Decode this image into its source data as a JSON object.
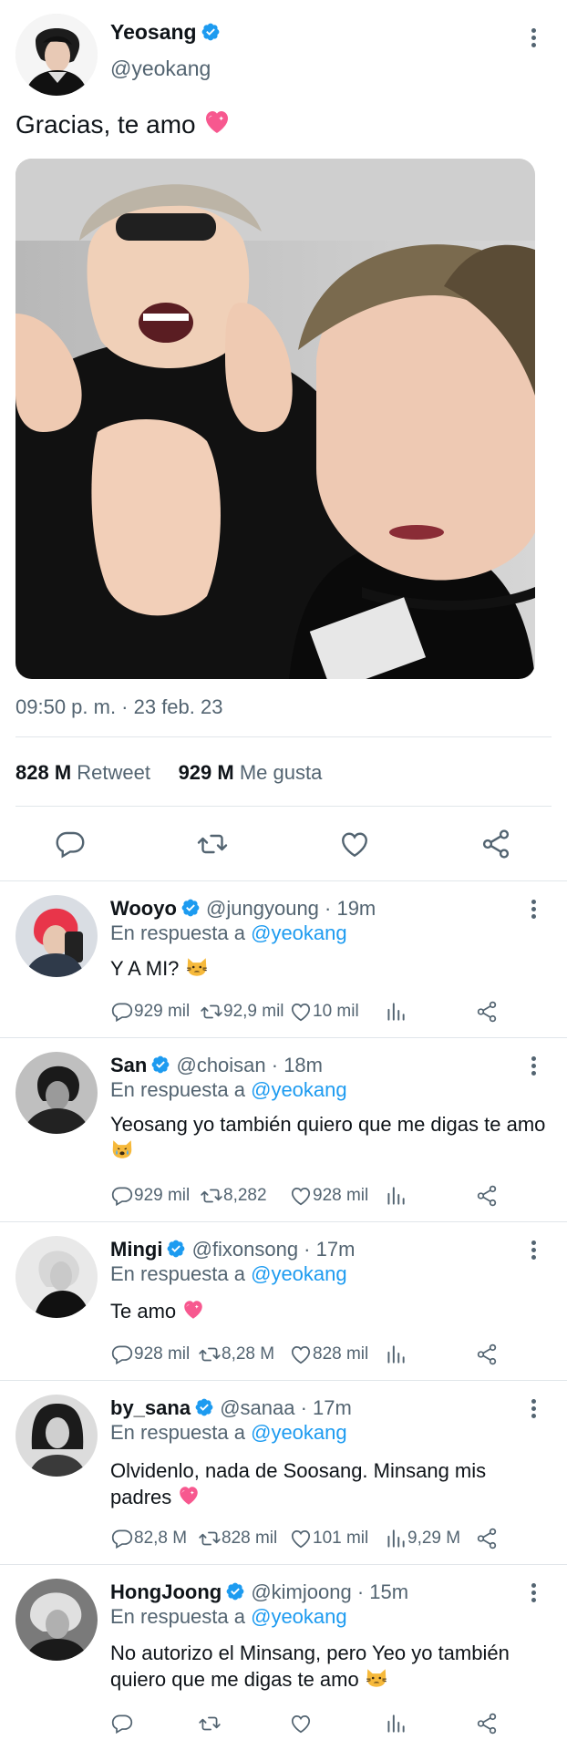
{
  "main_tweet": {
    "name": "Yeosang",
    "handle": "@yeokang",
    "text": "Gracias, te amo",
    "timestamp": "09:50 p. m. · 23 feb. 23",
    "retweets_count": "828 M",
    "retweets_label": "Retweet",
    "likes_count": "929 M",
    "likes_label": "Me gusta"
  },
  "reply_prefix": "En respuesta a",
  "reply_mention": "@yeokang",
  "replies": [
    {
      "name": "Wooyo",
      "handle": "@jungyoung · 19m",
      "text": "Y A MI?",
      "emoji": "cat",
      "comments": "929 mil",
      "retweets": "92,9 mil",
      "likes": "10 mil",
      "views": ""
    },
    {
      "name": "San",
      "handle": "@choisan · 18m",
      "text": "Yeosang yo también quiero que me digas te amo",
      "emoji": "crying-cat",
      "comments": "929 mil",
      "retweets": "8,282",
      "likes": "928 mil",
      "views": ""
    },
    {
      "name": "Mingi",
      "handle": "@fixonsong · 17m",
      "text": "Te amo",
      "emoji": "pink-heart",
      "comments": "928 mil",
      "retweets": "8,28 M",
      "likes": "828 mil",
      "views": ""
    },
    {
      "name": "by_sana",
      "handle": "@sanaa · 17m",
      "text": "Olvidenlo, nada de Soosang. Minsang mis padres",
      "emoji": "pink-heart",
      "comments": "82,8 M",
      "retweets": "828 mil",
      "likes": "101 mil",
      "views": "9,29 M"
    },
    {
      "name": "HongJoong",
      "handle": "@kimjoong · 15m",
      "text": "No autorizo el Minsang, pero Yeo yo también quiero que me digas te amo",
      "emoji": "cat",
      "comments": "",
      "retweets": "",
      "likes": "",
      "views": ""
    }
  ],
  "colors": {
    "accent": "#1d9bf0",
    "secondary_text": "#536471",
    "divider": "#e1e6ea"
  },
  "icons": [
    "verified-badge-icon",
    "more-vertical-icon",
    "reply-icon",
    "retweet-icon",
    "like-icon",
    "share-icon",
    "views-icon"
  ]
}
